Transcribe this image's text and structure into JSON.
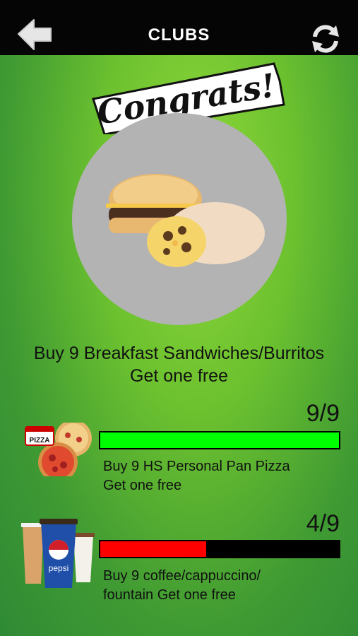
{
  "header": {
    "title": "CLUBS"
  },
  "hero": {
    "badge_text": "Congrats!",
    "description_line1": "Buy 9 Breakfast Sandwiches/Burritos",
    "description_line2": "Get one free"
  },
  "clubs": [
    {
      "score": "9/9",
      "progress": 1.0,
      "fill_color": "#00ff00",
      "line1": "Buy 9 HS Personal Pan Pizza",
      "line2": "Get one free",
      "thumb_label": "PIZZA"
    },
    {
      "score": "4/9",
      "progress": 0.444,
      "fill_color": "#ff0000",
      "line1": "Buy 9 coffee/cappuccino/",
      "line2": "fountain Get one free",
      "thumb_label": "pepsi"
    }
  ],
  "colors": {
    "topbar": "#050505",
    "accent_green": "#00ff00",
    "accent_red": "#ff0000"
  }
}
